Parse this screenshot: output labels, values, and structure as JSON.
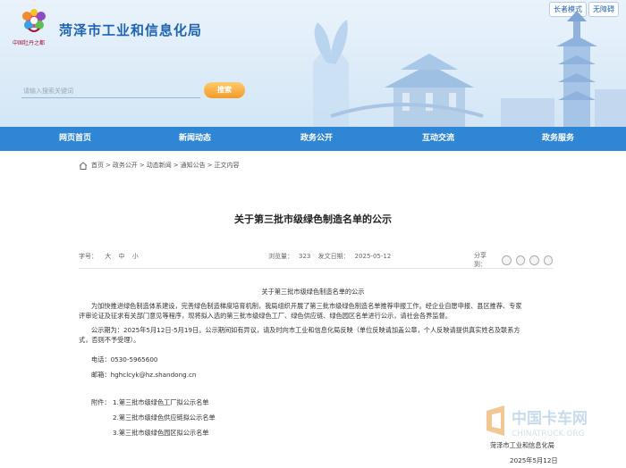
{
  "header": {
    "site_title": "菏泽市工业和信息化局",
    "logo_text": "中国牡丹之都",
    "top_buttons": [
      "长者模式",
      "无障碍"
    ],
    "search": {
      "placeholder": "请输入搜索关键词",
      "button_label": "搜索"
    }
  },
  "nav": {
    "items": [
      "网页首页",
      "新闻动态",
      "政务公开",
      "互动交流",
      "政务服务"
    ]
  },
  "breadcrumb": {
    "items": [
      "首页",
      "政务公开",
      "动态新闻",
      "通知公告",
      "正文内容"
    ],
    "separator": ">"
  },
  "article": {
    "title": "关于第三批市级绿色制造名单的公示",
    "font_size_label": "字号：",
    "font_sizes": [
      "大",
      "中",
      "小"
    ],
    "views_label": "浏览量：",
    "views": "323",
    "date_label": "发文日期：",
    "date": "2025-05-12",
    "share_label": "分享到：",
    "doc_heading": "关于第三批市级绿色制造名单的公示",
    "paragraph1": [
      "为加快推进绿色制造体系建设，完善绿色制造梯度培育机制，我局组织开展了第三批市级绿色制造名单推荐申报工作。经企业自愿申报、县区推荐、专家",
      "评审论证及征求有关部门意见等程序，现将拟入选的第三批市级绿色工厂、绿色供应链、绿色园区名单进行公示，请社会各界监督。"
    ],
    "paragraph2": [
      "公示期为：2025年5月12日-5月19日。公示期间如有异议，请及时向市工业和信息化局反映（单位反映请加盖公章，个人反映请提供真实姓名及联系方",
      "式，否则不予受理）。"
    ],
    "phone": "电话：0530-5965600",
    "email": "邮箱：hghclcyk@hz.shandong.cn",
    "attachments_label": "附件：",
    "attachments": [
      "1.第三批市级绿色工厂拟公示名单",
      "2.第三批市级绿色供应链拟公示名单",
      "3.第三批市级绿色园区拟公示名单"
    ],
    "signature": "菏泽市工业和信息化局",
    "sign_date": "2025年5月12日"
  },
  "watermark": {
    "title": "中国卡车网",
    "url": "CHINATRUCK.ORG"
  },
  "colors": {
    "nav": "#2f86d4",
    "title": "#1f63b4",
    "search_button": "#f39a2b"
  }
}
